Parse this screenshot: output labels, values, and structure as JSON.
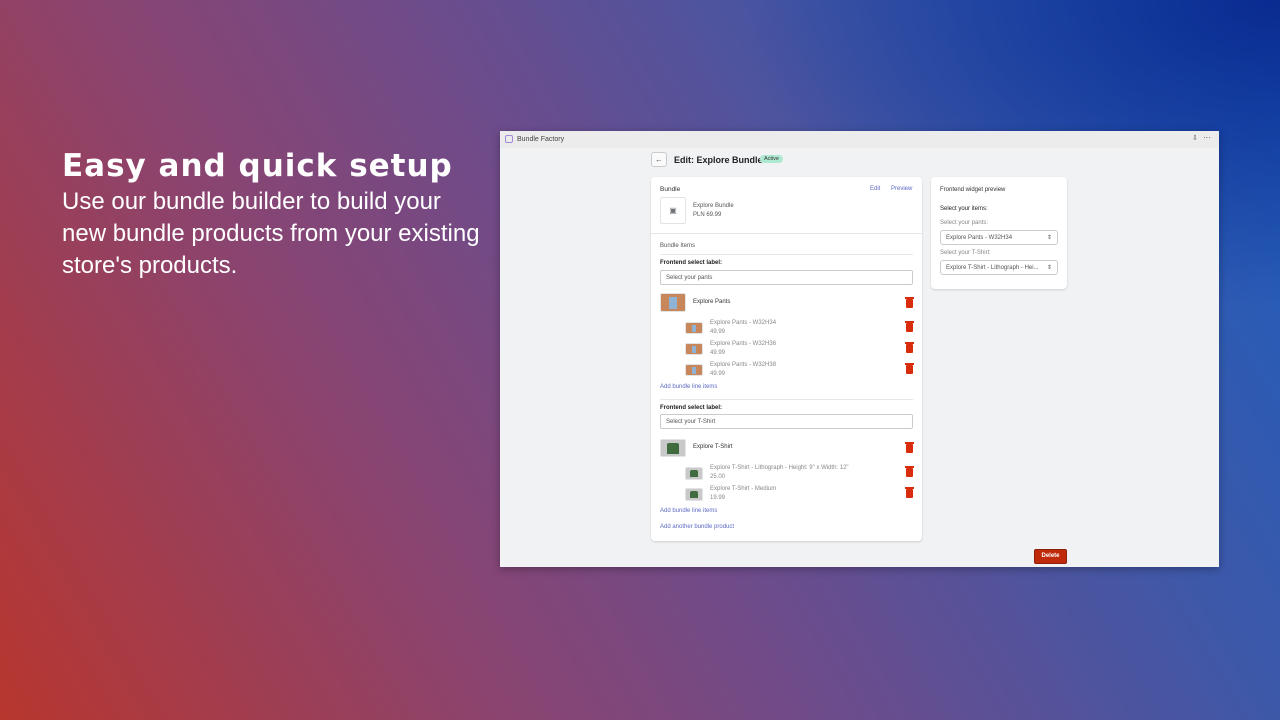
{
  "hero": {
    "title": "Easy and quick setup",
    "body": "Use our bundle builder to build your new bundle products from your existing store's products."
  },
  "app": {
    "name": "Bundle Factory",
    "page_title": "Edit: Explore Bundle",
    "status": "Active",
    "colors": {
      "status_bg": "#aee9d1",
      "danger": "#d82c0d",
      "link": "#5c6ac4"
    }
  },
  "bundle": {
    "heading": "Bundle",
    "edit": "Edit",
    "preview": "Preview",
    "name": "Explore Bundle",
    "price": "PLN 69.99"
  },
  "items": {
    "heading": "Bundle Items",
    "groups": [
      {
        "label": "Frontend select label:",
        "input": "Select your pants",
        "product": "Explore Pants",
        "lines": [
          {
            "name": "Explore Pants - W32H34",
            "price": "49.99"
          },
          {
            "name": "Explore Pants - W32H36",
            "price": "49.99"
          },
          {
            "name": "Explore Pants - W32H38",
            "price": "49.99"
          }
        ],
        "add": "Add bundle line items"
      },
      {
        "label": "Frontend select label:",
        "input": "Select your T-Shirt",
        "product": "Explore T-Shirt",
        "lines": [
          {
            "name": "Explore T-Shirt - Lithograph - Height: 9\" x Width: 12\"",
            "price": "25.00"
          },
          {
            "name": "Explore T-Shirt - Medium",
            "price": "19.99"
          }
        ],
        "add": "Add bundle line items"
      }
    ],
    "add_product": "Add another bundle product"
  },
  "preview": {
    "heading": "Frontend widget preview",
    "subheading": "Select your items:",
    "fields": [
      {
        "label": "Select your pants:",
        "value": "Explore Pants - W32H34"
      },
      {
        "label": "Select your T-Shirt:",
        "value": "Explore T-Shirt - Lithograph - Hei..."
      }
    ]
  },
  "delete": "Delete"
}
